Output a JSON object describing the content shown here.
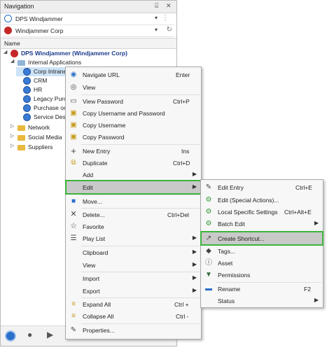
{
  "panel": {
    "title": "Navigation",
    "pin_glyph": "⍄",
    "close_glyph": "✕",
    "datasource": "DPS Windjammer",
    "vault": "Windjammer Corp",
    "column_header": "Name"
  },
  "tree": {
    "root": "DPS Windjammer (Windjammer Corp)",
    "internal_apps": "Internal Applications",
    "entries": [
      "Corp Intranet",
      "CRM",
      "HR",
      "Legacy Purcha",
      "Purchase order",
      "Service Desk"
    ],
    "network": "Network",
    "social_media": "Social Media",
    "suppliers": "Suppliers"
  },
  "context_menu": {
    "navigate_url": "Navigate URL",
    "navigate_url_sc": "Enter",
    "view": "View",
    "view_password": "View Password",
    "view_password_sc": "Ctrl+P",
    "copy_user_pass": "Copy Username and Password",
    "copy_username": "Copy Username",
    "copy_password": "Copy Password",
    "new_entry": "New Entry",
    "new_entry_sc": "Ins",
    "duplicate": "Duplicate",
    "duplicate_sc": "Ctrl+D",
    "add": "Add",
    "edit": "Edit",
    "move": "Move...",
    "delete": "Delete...",
    "delete_sc": "Ctrl+Del",
    "favorite": "Favorite",
    "play_list": "Play List",
    "clipboard": "Clipboard",
    "view_sub": "View",
    "import": "Import",
    "export": "Export",
    "expand_all": "Expand All",
    "expand_all_sc": "Ctrl +",
    "collapse_all": "Collapse All",
    "collapse_all_sc": "Ctrl -",
    "properties": "Properties..."
  },
  "edit_submenu": {
    "edit_entry": "Edit Entry",
    "edit_entry_sc": "Ctrl+E",
    "edit_special": "Edit (Special Actions)...",
    "local_specific": "Local Specific Settings",
    "local_specific_sc": "Ctrl+Alt+E",
    "batch_edit": "Batch Edit",
    "create_shortcut": "Create Shortcut...",
    "tags": "Tags...",
    "asset": "Asset",
    "permissions": "Permissions",
    "rename": "Rename",
    "rename_sc": "F2",
    "status": "Status"
  },
  "glyphs": {
    "submenu_arrow": "▶",
    "dropdown": "▾",
    "expanded": "◢",
    "collapsed": "▷"
  },
  "colors": {
    "highlight_outline": "#3cb43c",
    "selected_row": "#cde3f7",
    "dps_red": "#c62828",
    "globe_blue": "#3a7bd5"
  }
}
